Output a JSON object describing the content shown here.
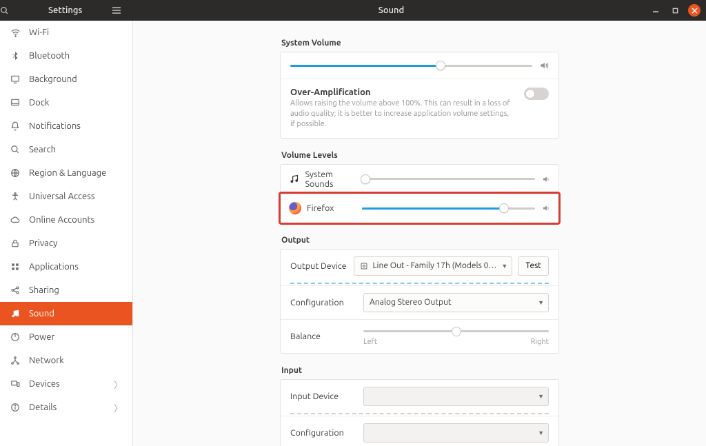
{
  "header": {
    "left_title": "Settings",
    "center_title": "Sound"
  },
  "sidebar": {
    "items": [
      {
        "label": "Wi-Fi"
      },
      {
        "label": "Bluetooth"
      },
      {
        "label": "Background"
      },
      {
        "label": "Dock"
      },
      {
        "label": "Notifications"
      },
      {
        "label": "Search"
      },
      {
        "label": "Region & Language"
      },
      {
        "label": "Universal Access"
      },
      {
        "label": "Online Accounts"
      },
      {
        "label": "Privacy"
      },
      {
        "label": "Applications"
      },
      {
        "label": "Sharing"
      },
      {
        "label": "Sound"
      },
      {
        "label": "Power"
      },
      {
        "label": "Network"
      },
      {
        "label": "Devices"
      },
      {
        "label": "Details"
      }
    ]
  },
  "sound": {
    "system_volume_title": "System Volume",
    "system_volume_percent": 62,
    "over_amp": {
      "title": "Over-Amplification",
      "desc": "Allows raising the volume above 100%. This can result in a loss of audio quality; it is better to increase application volume settings, if possible.",
      "enabled": false
    },
    "volume_levels_title": "Volume Levels",
    "apps": [
      {
        "name": "System Sounds",
        "percent": 2
      },
      {
        "name": "Firefox",
        "percent": 82
      }
    ],
    "output_title": "Output",
    "output": {
      "device_label": "Output Device",
      "device_value": "Line Out - Family 17h (Models 0…",
      "test_label": "Test",
      "config_label": "Configuration",
      "config_value": "Analog Stereo Output",
      "balance_label": "Balance",
      "balance_left": "Left",
      "balance_right": "Right"
    },
    "input_title": "Input",
    "input": {
      "device_label": "Input Device",
      "device_value": "",
      "config_label": "Configuration",
      "config_value": ""
    }
  }
}
